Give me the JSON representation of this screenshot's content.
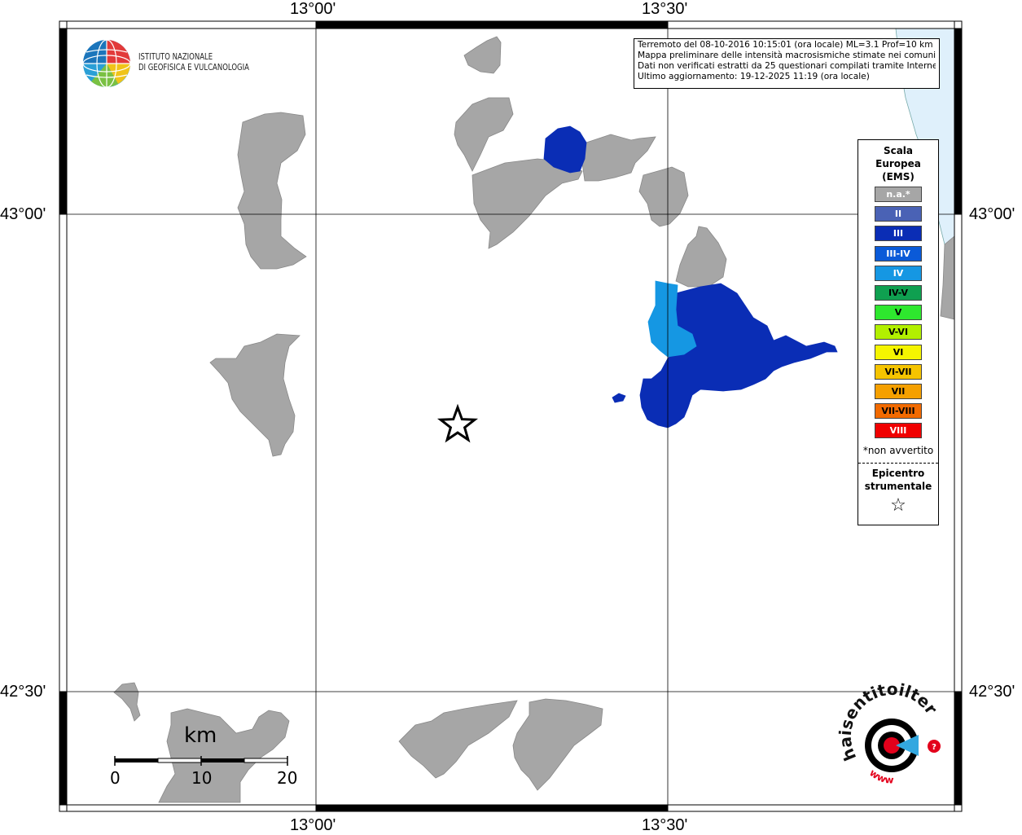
{
  "map": {
    "lon_ticks": [
      "13°00'",
      "13°30'"
    ],
    "lat_ticks": [
      "43°00'",
      "42°30'"
    ]
  },
  "institute": {
    "line1": "ISTITUTO NAZIONALE",
    "line2": "DI GEOFISICA E VULCANOLOGIA"
  },
  "info": {
    "line1": "Terremoto del 08-10-2016 10:15:01 (ora locale) ML=3.1 Prof=10 km",
    "line2": "Mappa preliminare delle intensità macrosismiche stimate nei comuni",
    "line3": "Dati non verificati estratti da 25 questionari compilati tramite Internet.",
    "line4": "Ultimo aggiornamento: 19-12-2025 11:19 (ora locale)"
  },
  "legend": {
    "title_line1": "Scala",
    "title_line2": "Europea",
    "title_line3": "(EMS)",
    "items": [
      {
        "label": "n.a.*",
        "color": "#a6a6a6",
        "text_color": "#ffffff"
      },
      {
        "label": "II",
        "color": "#4a62b5",
        "text_color": "#ffffff"
      },
      {
        "label": "III",
        "color": "#0a2db5",
        "text_color": "#ffffff"
      },
      {
        "label": "III-IV",
        "color": "#0a5ad8",
        "text_color": "#ffffff"
      },
      {
        "label": "IV",
        "color": "#1597e3",
        "text_color": "#ffffff"
      },
      {
        "label": "IV-V",
        "color": "#0fa050",
        "text_color": "#000000"
      },
      {
        "label": "V",
        "color": "#2ee82e",
        "text_color": "#000000"
      },
      {
        "label": "V-VI",
        "color": "#b2f000",
        "text_color": "#000000"
      },
      {
        "label": "VI",
        "color": "#f5f500",
        "text_color": "#000000"
      },
      {
        "label": "VI-VII",
        "color": "#f5c400",
        "text_color": "#000000"
      },
      {
        "label": "VII",
        "color": "#f5a000",
        "text_color": "#000000"
      },
      {
        "label": "VII-VIII",
        "color": "#f26a00",
        "text_color": "#000000"
      },
      {
        "label": "VIII",
        "color": "#f00000",
        "text_color": "#ffffff"
      }
    ],
    "note": "*non avvertito",
    "epicenter_line1": "Epicentro",
    "epicenter_line2": "strumentale",
    "epicenter_symbol": "☆"
  },
  "scale": {
    "unit": "km",
    "labels": [
      "0",
      "10",
      "20"
    ]
  },
  "haisentito": {
    "text": "haisentitoilterremoto.it",
    "url": "www"
  },
  "colors": {
    "not_available": "#a6a6a6",
    "intensity_III": "#0a2db5",
    "intensity_IV": "#1597e3",
    "sea": "#dff0fb"
  }
}
